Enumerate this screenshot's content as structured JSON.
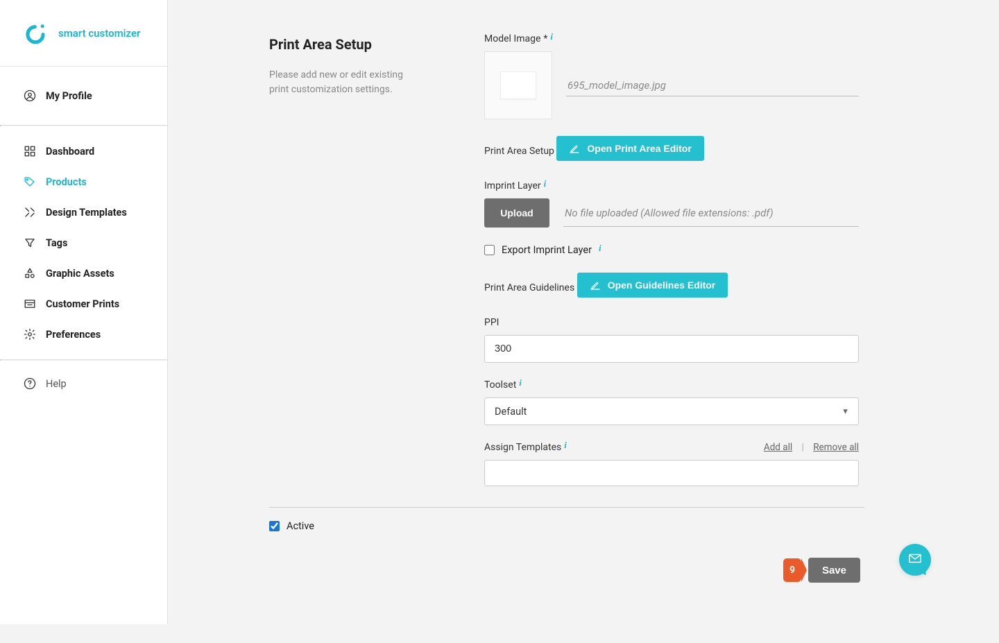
{
  "brand": {
    "name": "smart customizer"
  },
  "sidebar": {
    "profile_label": "My Profile",
    "items": [
      {
        "label": "Dashboard"
      },
      {
        "label": "Products"
      },
      {
        "label": "Design Templates"
      },
      {
        "label": "Tags"
      },
      {
        "label": "Graphic Assets"
      },
      {
        "label": "Customer Prints"
      },
      {
        "label": "Preferences"
      }
    ],
    "help_label": "Help"
  },
  "page": {
    "title": "Print Area Setup",
    "description": "Please add new or edit existing print customization settings."
  },
  "form": {
    "model_image_label": "Model Image",
    "required_star": "*",
    "model_image_filename": "695_model_image.jpg",
    "print_area_setup_label": "Print Area Setup",
    "open_print_area_editor": "Open Print Area Editor",
    "imprint_layer_label": "Imprint Layer",
    "upload_label": "Upload",
    "no_file_text": "No file uploaded (Allowed file extensions: .pdf)",
    "export_imprint_layer_label": "Export Imprint Layer",
    "export_imprint_layer_checked": false,
    "print_area_guidelines_label": "Print Area Guidelines",
    "open_guidelines_editor": "Open Guidelines Editor",
    "ppi_label": "PPI",
    "ppi_value": "300",
    "toolset_label": "Toolset",
    "toolset_value": "Default",
    "assign_templates_label": "Assign Templates",
    "add_all_label": "Add all",
    "remove_all_label": "Remove all",
    "active_label": "Active",
    "active_checked": true
  },
  "footer": {
    "badge_count": "9",
    "save_label": "Save"
  }
}
